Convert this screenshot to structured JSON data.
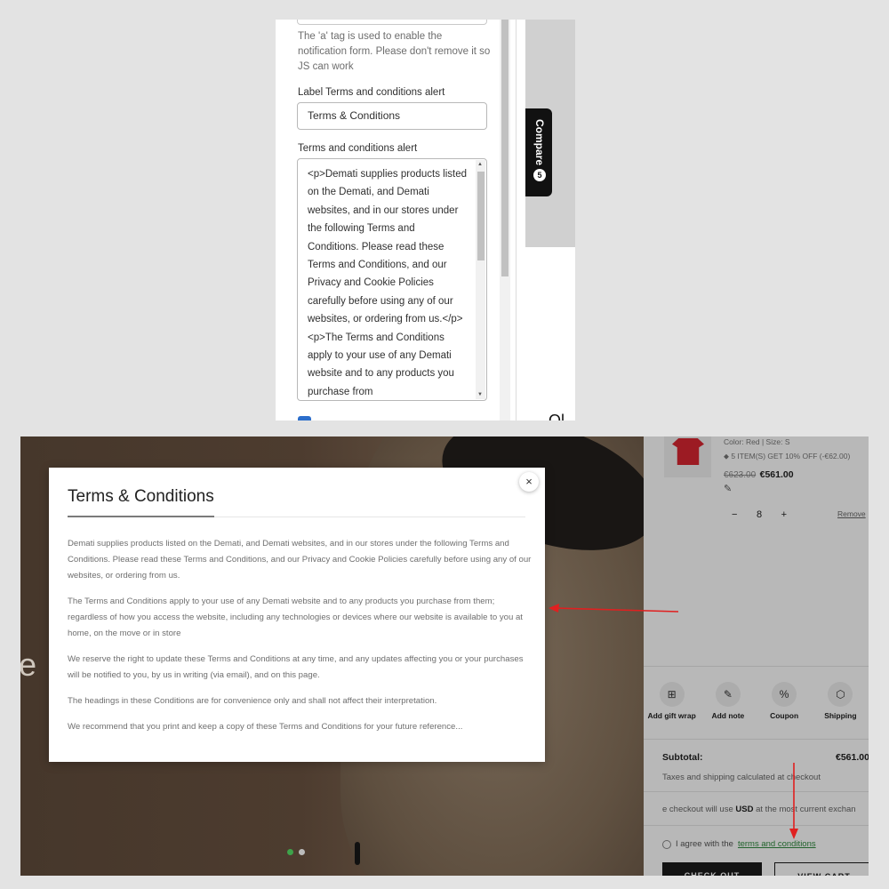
{
  "editor": {
    "help_text": "The 'a' tag is used to enable the notification form. Please don't remove it so JS can work",
    "label_field_label": "Label Terms and conditions alert",
    "label_field_value": "Terms & Conditions",
    "alert_field_label": "Terms and conditions alert",
    "alert_field_value": "<p>Demati supplies products listed on the Demati, and Demati websites, and in our stores under the following Terms and Conditions. Please read these Terms and Conditions, and our Privacy and Cookie Policies carefully before using any of our websites, or ordering from us.</p><p>The Terms and Conditions apply to your use of any Demati website and to any products you purchase from",
    "compare_label": "Compare",
    "compare_count": "5",
    "cut_text": "Ol"
  },
  "storefront": {
    "hero_text": "le",
    "modal": {
      "title": "Terms & Conditions",
      "close_icon": "×",
      "paragraphs": [
        "Demati supplies products listed on the Demati, and Demati websites, and in our stores under the following Terms and Conditions. Please read these Terms and Conditions, and our Privacy and Cookie Policies carefully before using any of our websites, or ordering from us.",
        "The Terms and Conditions apply to your use of any Demati website and to any products you purchase from them; regardless of how you access the website, including any technologies or devices where our website is available to you at home, on the move or in store",
        "We reserve the right to update these Terms and Conditions at any time, and any updates affecting you or your purchases will be notified to you, by us in writing (via email), and on this page.",
        "The headings in these Conditions are for convenience only and shall not affect their interpretation.",
        "We recommend that you print and keep a copy of these Terms and Conditions for your future reference..."
      ]
    },
    "cart": {
      "variant": "Color: Red  |  Size: S",
      "discount": "5 ITEM(S) GET 10% OFF (-€62.00)",
      "old_price": "€623.00",
      "price": "€561.00",
      "quantity": "8",
      "qty_minus": "−",
      "qty_plus": "+",
      "remove_label": "Remove",
      "actions": [
        {
          "label": "Add gift wrap",
          "icon": "gift-icon",
          "glyph": "⊞"
        },
        {
          "label": "Add note",
          "icon": "pencil-icon",
          "glyph": "✎"
        },
        {
          "label": "Coupon",
          "icon": "percent-icon",
          "glyph": "%"
        },
        {
          "label": "Shipping",
          "icon": "box-icon",
          "glyph": "⬡"
        }
      ],
      "subtotal_label": "Subtotal:",
      "subtotal_value": "€561.00",
      "taxes_note": "Taxes and shipping calculated at checkout",
      "currency_prefix": "e checkout will use ",
      "currency_code": "USD",
      "currency_suffix": " at the most current exchan",
      "agree_prefix": "I agree with the ",
      "agree_link": "terms and conditions",
      "checkout_label": "CHECK OUT",
      "view_cart_label": "VIEW CART"
    }
  },
  "colors": {
    "annotation_arrow": "#e02020",
    "link_green": "#2f8a3e",
    "checkbox_blue": "#2c6ecb"
  }
}
